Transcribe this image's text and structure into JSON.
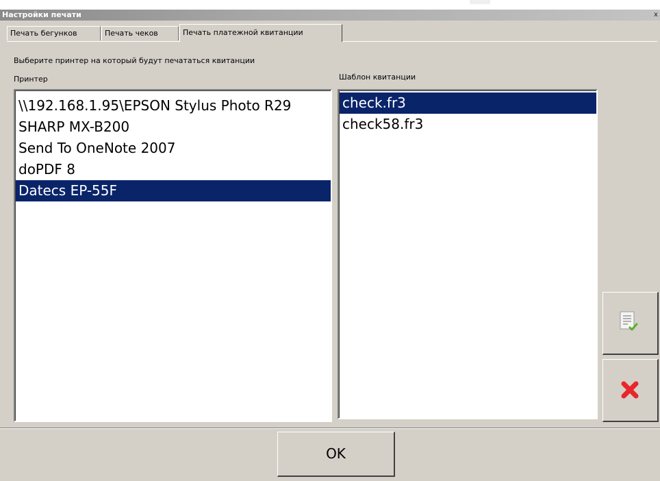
{
  "window": {
    "title": "Настройки печати",
    "close_glyph": "x"
  },
  "tabs": [
    {
      "label": "Печать бегунков",
      "active": false
    },
    {
      "label": "Печать чеков",
      "active": false
    },
    {
      "label": "Печать платежной квитанции",
      "active": true
    }
  ],
  "panel": {
    "instruction": "Выберите принтер на который будут печататься квитанции",
    "printer_label": "Принтер",
    "template_label": "Шаблон квитанции"
  },
  "printers": {
    "items": [
      "\\\\192.168.1.95\\EPSON Stylus Photo R29",
      "SHARP MX-B200",
      "Send To OneNote 2007",
      "doPDF 8",
      "Datecs EP-55F"
    ],
    "selected": "Datecs EP-55F"
  },
  "templates": {
    "items": [
      "check.fr3",
      "check58.fr3"
    ],
    "selected": "check.fr3"
  },
  "side_buttons": {
    "apply_icon": "document-check-icon",
    "delete_icon": "red-x-icon"
  },
  "footer": {
    "ok_label": "OK"
  },
  "colors": {
    "selection_bg": "#0a246a",
    "selection_fg": "#ffffff",
    "delete_red": "#e8262b",
    "check_green": "#5ab02a"
  }
}
